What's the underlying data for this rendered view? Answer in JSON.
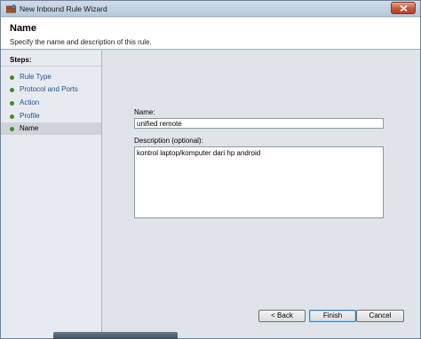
{
  "window": {
    "title": "New Inbound Rule Wizard",
    "icons": {
      "app": "firewall-shield-icon",
      "close": "close-x-icon"
    }
  },
  "header": {
    "title": "Name",
    "subtitle": "Specify the name and description of this rule."
  },
  "steps": {
    "heading": "Steps:",
    "items": [
      {
        "label": "Rule Type",
        "current": false
      },
      {
        "label": "Protocol and Ports",
        "current": false
      },
      {
        "label": "Action",
        "current": false
      },
      {
        "label": "Profile",
        "current": false
      },
      {
        "label": "Name",
        "current": true
      }
    ]
  },
  "form": {
    "name_label": "Name:",
    "name_value": "unified remote",
    "description_label": "Description (optional):",
    "description_value": "kontrol laptop/komputer dari hp android"
  },
  "buttons": {
    "back": "< Back",
    "finish": "Finish",
    "cancel": "Cancel"
  },
  "colors": {
    "step_bullet": "#3e8e24",
    "step_link": "#1f4f8f",
    "close_button": "#c6553c"
  }
}
